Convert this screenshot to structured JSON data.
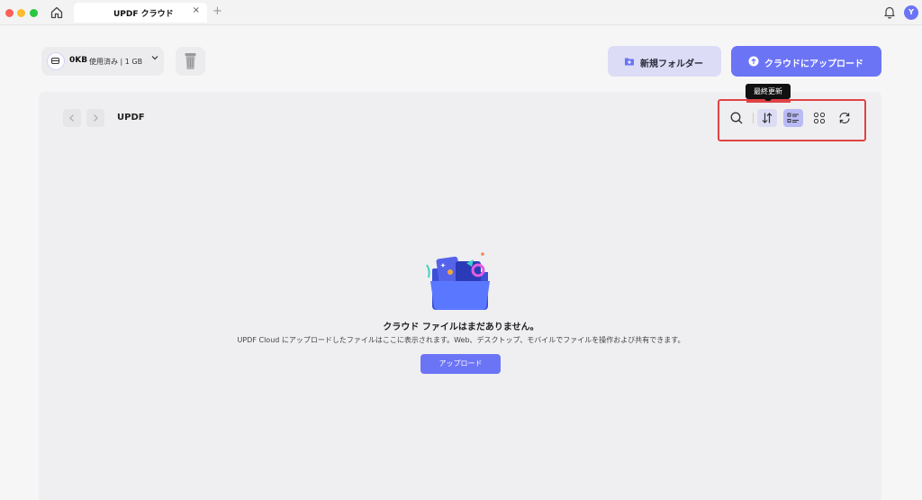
{
  "titlebar": {
    "tab_title": "UPDF クラウド",
    "tab_close": "×",
    "tab_add": "+",
    "avatar_initial": "Y"
  },
  "storage": {
    "used": "0KB",
    "detail": "使用済み | 1 GB"
  },
  "header": {
    "new_folder_label": "新規フォルダー",
    "upload_label": "クラウドにアップロード"
  },
  "breadcrumb": {
    "current": "UPDF"
  },
  "toolbar": {
    "tooltip": "最終更新"
  },
  "empty_state": {
    "title": "クラウド ファイルはまだありません。",
    "description": "UPDF Cloud にアップロードしたファイルはここに表示されます。Web、デスクトップ、モバイルでファイルを操作および共有できます。",
    "upload_button": "アップロード"
  },
  "colors": {
    "accent": "#6c74f6",
    "accent_light": "#dcdcf6",
    "highlight_red": "#e04246"
  }
}
